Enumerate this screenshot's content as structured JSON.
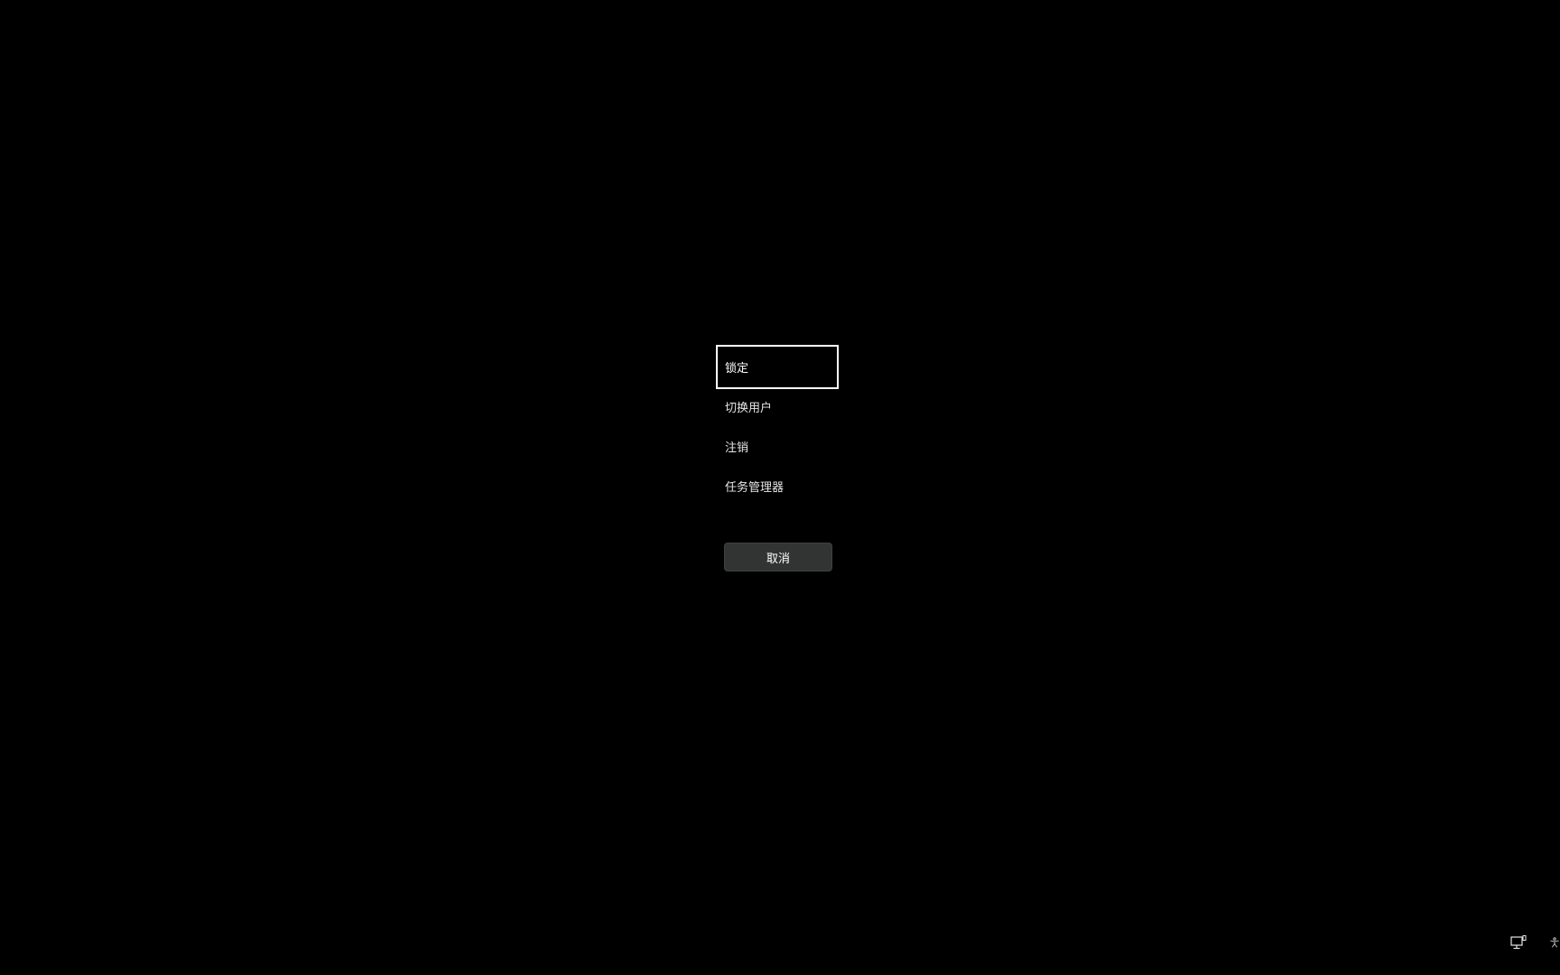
{
  "menu": {
    "items": [
      {
        "label": "锁定"
      },
      {
        "label": "切换用户"
      },
      {
        "label": "注销"
      },
      {
        "label": "任务管理器"
      }
    ]
  },
  "cancel_button": {
    "label": "取消"
  },
  "corner_icons": {
    "network": "network-icon",
    "accessibility": "accessibility-icon"
  },
  "colors": {
    "background": "#000000",
    "text": "#e6e6e6",
    "focus_border": "#ffffff",
    "button_bg": "#323433"
  }
}
